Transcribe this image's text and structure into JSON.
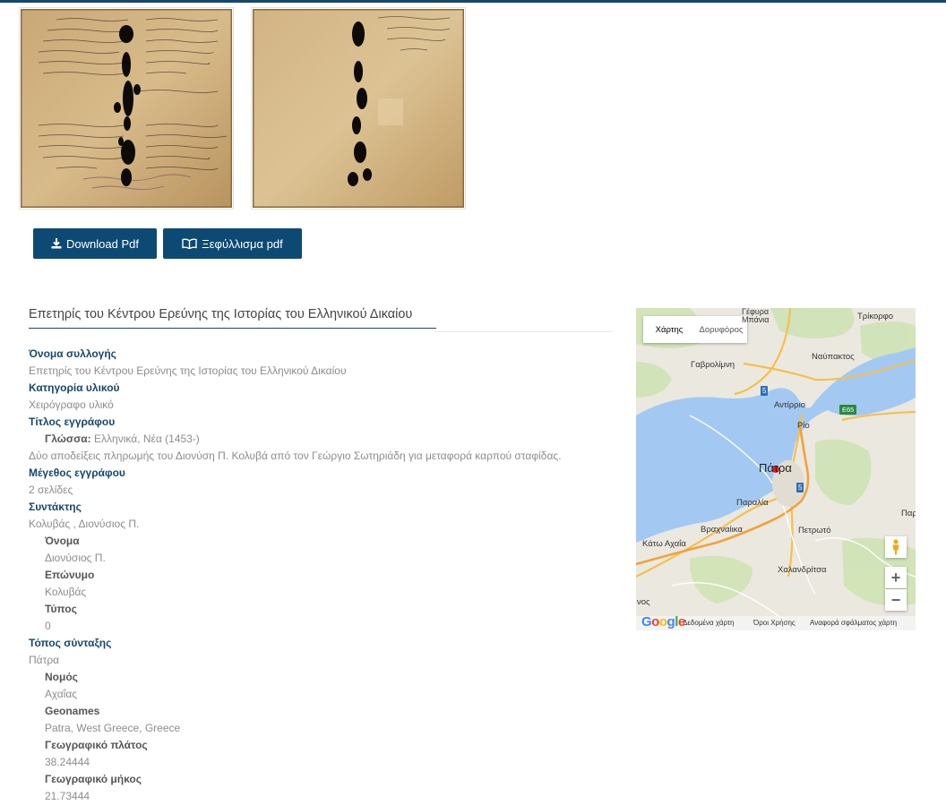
{
  "buttons": {
    "download_pdf": "Download Pdf",
    "flip_pdf": "Ξεφύλλισμα pdf"
  },
  "collection_title": "Επετηρίς του Κέντρου Ερεύνης της Ιστορίας του Ελληνικού Δικαίου",
  "fields": {
    "collection_name_label": "Όνομα συλλογής",
    "collection_name_value": "Επετηρίς του Κέντρου Ερεύνης της Ιστορίας του Ελληνικού Δικαίου",
    "category_label": "Κατηγορία υλικού",
    "category_value": "Χειρόγραφο υλικό",
    "doc_title_label": "Τίτλος εγγράφου",
    "language_label": "Γλώσσα:",
    "language_value": "Ελληνικά, Νέα (1453-)",
    "doc_title_value": "Δύο αποδείξεις πληρωμής του Διονύση Π. Κολυβά από τον Γεώργιο Σωτηριάδη για μεταφορά καρπού σταφίδας.",
    "doc_size_label": "Μέγεθος εγγράφου",
    "doc_size_value": "2 σελίδες",
    "author_label": "Συντάκτης",
    "author_value": "Κολυβάς , Διονύσιος Π.",
    "first_name_label": "Όνομα",
    "first_name_value": "Διονύσιος Π.",
    "last_name_label": "Επώνυμο",
    "last_name_value": "Κολυβάς",
    "type_label": "Τύπος",
    "type_value": "0",
    "place_label": "Τόπος σύνταξης",
    "place_value": "Πάτρα",
    "prefecture_label": "Νομός",
    "prefecture_value": "Αχαΐας",
    "geonames_label": "Geonames",
    "geonames_value": "Patra, West Greece, Greece",
    "lat_label": "Γεωγραφικό πλάτος",
    "lat_value": "38.24444",
    "lon_label": "Γεωγραφικό μήκος",
    "lon_value": "21.73444"
  },
  "map": {
    "type_map": "Χάρτης",
    "type_satellite": "Δορυφόρος",
    "labels": {
      "gefyra": "Γέφυρα",
      "mpania": "Μπάνια",
      "trikorfo": "Τρίκορφο",
      "nafpaktos": "Ναύπακτος",
      "gavrolimni": "Γαβρολίμνη",
      "antirrio": "Αντίρριο",
      "rio": "Ρίο",
      "patra": "Πάτρα",
      "paralia": "Παραλία",
      "vrachnaika": "Βραχναίικα",
      "petroto": "Πετρωτό",
      "kato_achaia": "Κάτω Αχαΐα",
      "chalandritsa": "Χαλανδρίτσα",
      "nos": "νος",
      "par": "Παρ"
    },
    "shields": {
      "road5a": "5",
      "road5b": "5",
      "e65": "E65"
    },
    "footer": {
      "map_data": "Δεδομένα χάρτη",
      "terms": "Όροι Χρήσης",
      "report": "Αναφορά σφάλματος χάρτη"
    },
    "google": "Google",
    "zoom_in": "+",
    "zoom_out": "−"
  },
  "colors": {
    "accent": "#17476b",
    "button": "#0d4a73",
    "water": "#a3c9f2"
  }
}
